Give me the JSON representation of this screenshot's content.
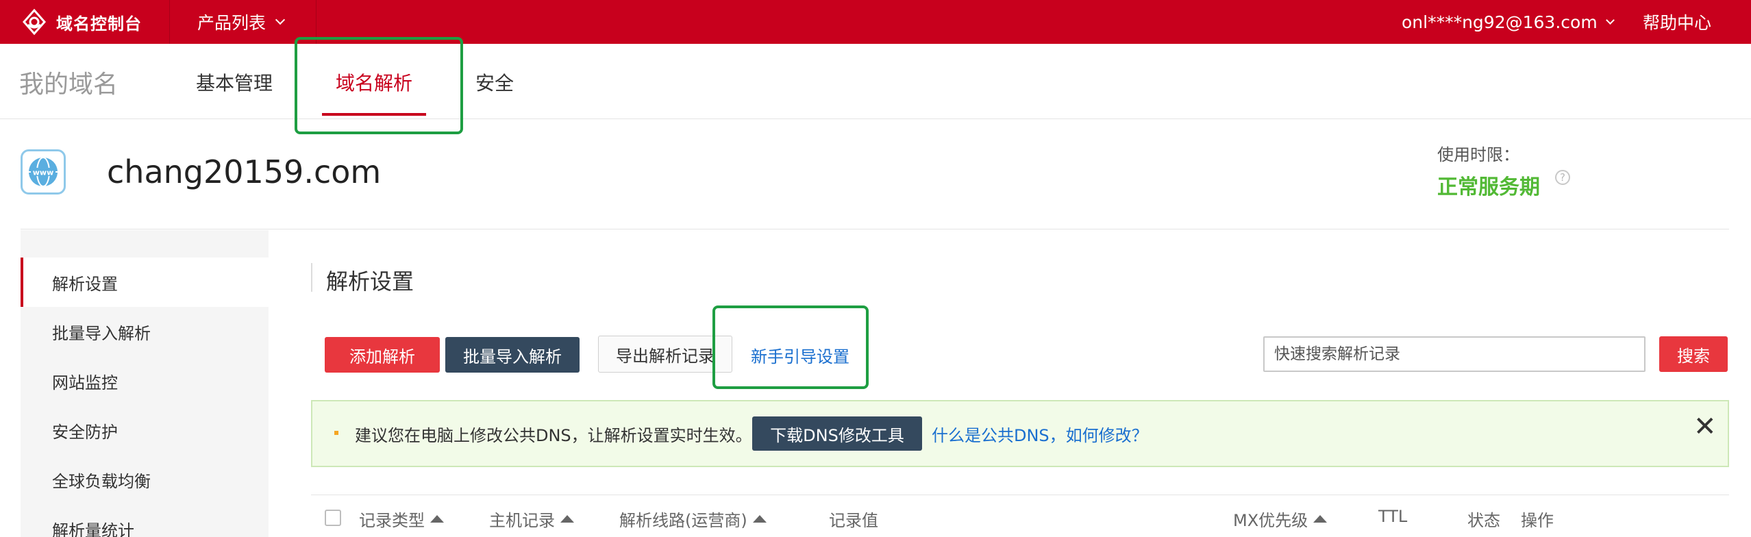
{
  "topbar": {
    "brand": "域名控制台",
    "products": "产品列表",
    "account": "onl****ng92@163.com",
    "help": "帮助中心"
  },
  "subnav": {
    "title": "我的域名",
    "tabs": [
      {
        "label": "基本管理",
        "active": false
      },
      {
        "label": "域名解析",
        "active": true
      },
      {
        "label": "安全",
        "active": false
      }
    ]
  },
  "domain": {
    "name": "chang20159.com",
    "icon": "www-globe-icon",
    "usage_label": "使用时限：",
    "usage_status": "正常服务期",
    "help_icon": "?"
  },
  "sidebar": {
    "items": [
      {
        "label": "解析设置",
        "active": true
      },
      {
        "label": "批量导入解析",
        "active": false
      },
      {
        "label": "网站监控",
        "active": false
      },
      {
        "label": "安全防护",
        "active": false
      },
      {
        "label": "全球负载均衡",
        "active": false
      },
      {
        "label": "解析量统计",
        "active": false
      }
    ]
  },
  "main": {
    "title": "解析设置",
    "buttons": {
      "add": "添加解析",
      "batch_import": "批量导入解析",
      "export": "导出解析记录",
      "guide": "新手引导设置"
    },
    "search": {
      "placeholder": "快速搜索解析记录",
      "button": "搜索"
    },
    "notice": {
      "text": "建议您在电脑上修改公共DNS，让解析设置实时生效。",
      "download_button": "下载DNS修改工具",
      "link": "什么是公共DNS，如何修改？",
      "close": "✕"
    },
    "table": {
      "headers": [
        {
          "label": "记录类型",
          "sortable": true
        },
        {
          "label": "主机记录",
          "sortable": true
        },
        {
          "label": "解析线路(运营商)",
          "sortable": true
        },
        {
          "label": "记录值",
          "sortable": false
        },
        {
          "label": "MX优先级",
          "sortable": true
        },
        {
          "label": "TTL",
          "sortable": false
        },
        {
          "label": "状态",
          "sortable": false
        },
        {
          "label": "操作",
          "sortable": false
        }
      ]
    }
  },
  "colors": {
    "brand_red": "#c8001d",
    "button_red": "#e8373e",
    "button_dark": "#34495e",
    "status_green": "#52b935",
    "link_blue": "#1a6fcf",
    "highlight_green": "#1e9e42"
  }
}
